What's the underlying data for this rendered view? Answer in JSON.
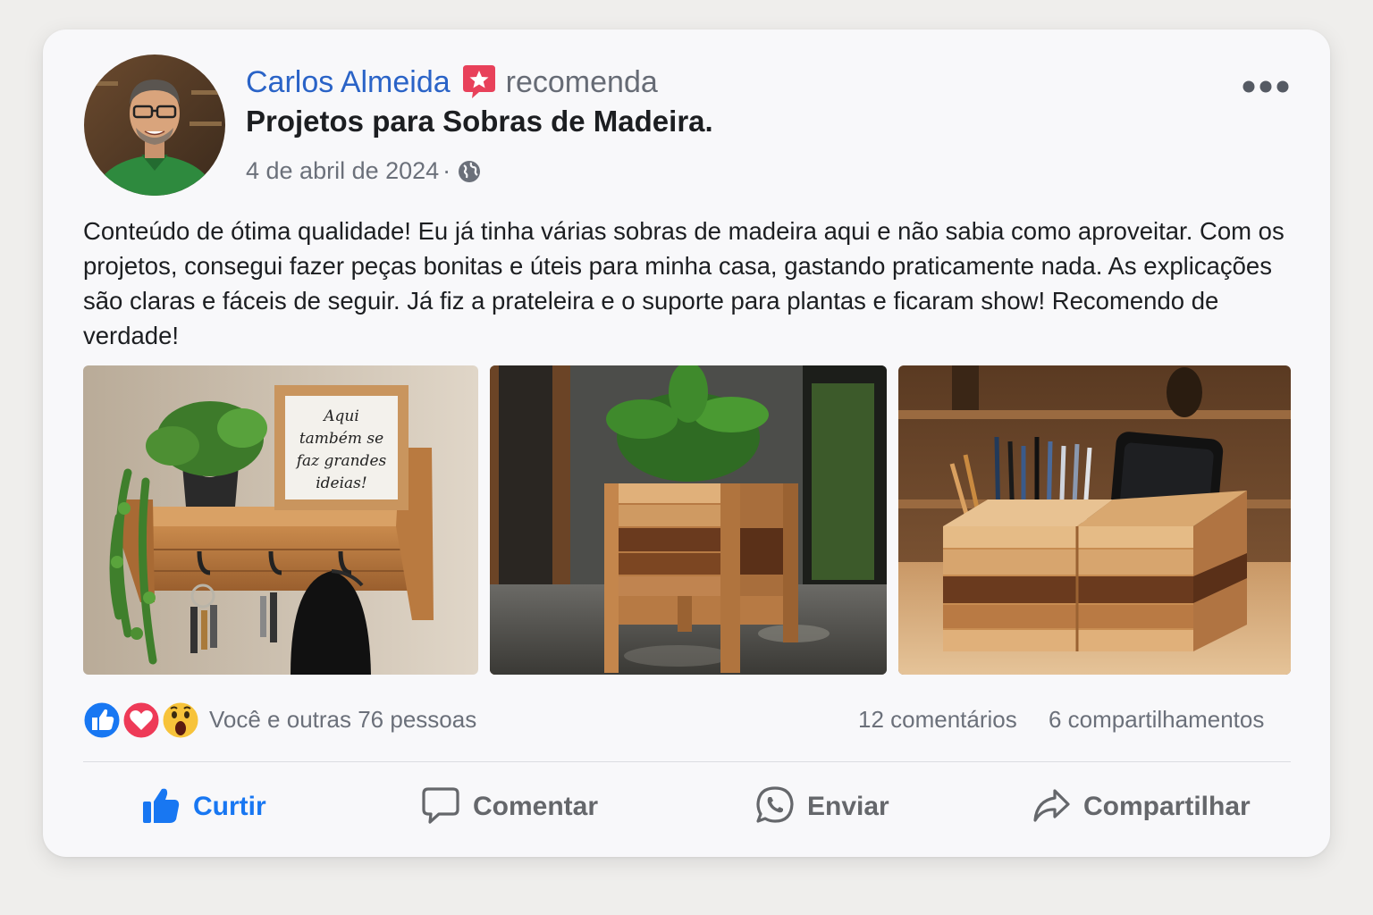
{
  "post": {
    "author": "Carlos Almeida",
    "action_text": "recomenda",
    "page_title": "Projetos para Sobras de Madeira.",
    "date": "4 de abril de 2024",
    "separator": "·",
    "privacy_icon": "globe-icon",
    "badge_icon": "recommend-star-icon",
    "body": "Conteúdo de ótima qualidade! Eu já tinha várias sobras de madeira aqui e não sabia como aproveitar. Com os projetos, consegui fazer peças bonitas e úteis para minha casa, gastando praticamente nada. As explicações são claras e fáceis de seguir. Já fiz a prateleira e o suporte para plantas e ficaram show! Recomendo de verdade!",
    "photos": [
      {
        "name": "wall-shelf-photo",
        "sign_text": [
          "Aqui",
          "também se",
          "faz grandes",
          "ideias!"
        ]
      },
      {
        "name": "planter-box-photo"
      },
      {
        "name": "desk-organizer-photo"
      }
    ]
  },
  "stats": {
    "reactions": [
      "like",
      "love",
      "wow"
    ],
    "reaction_text": "Você e outras 76 pessoas",
    "comments": "12 comentários",
    "shares": "6 compartilhamentos"
  },
  "actions": {
    "like": {
      "label": "Curtir",
      "icon": "thumbs-up-icon",
      "active": true
    },
    "comment": {
      "label": "Comentar",
      "icon": "comment-icon"
    },
    "send": {
      "label": "Enviar",
      "icon": "whatsapp-icon"
    },
    "share": {
      "label": "Compartilhar",
      "icon": "share-arrow-icon"
    }
  },
  "colors": {
    "author_link": "#2a63c7",
    "like_active": "#1877f2",
    "muted_text": "#6b707a",
    "badge": "#e8415a"
  }
}
